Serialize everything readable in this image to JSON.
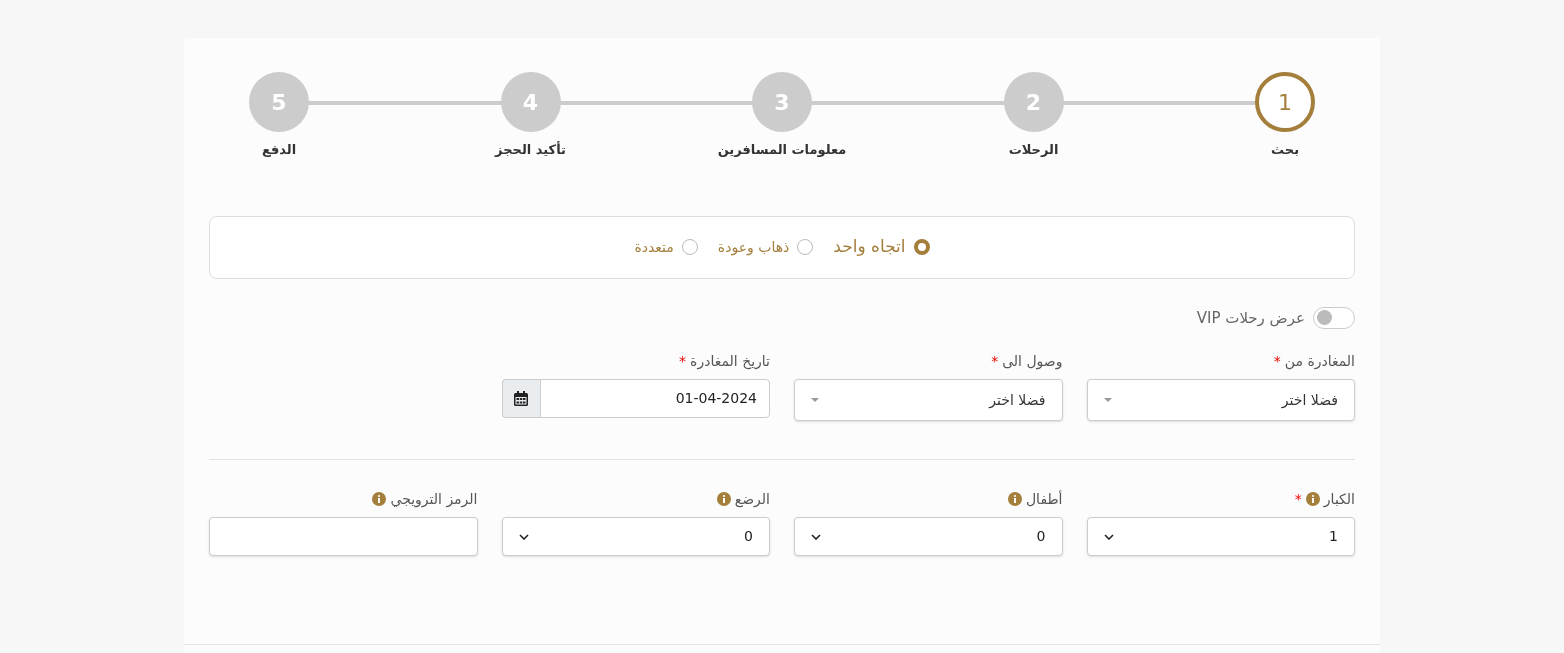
{
  "steps": [
    {
      "number": "1",
      "label": "بحث",
      "selected": true
    },
    {
      "number": "2",
      "label": "الرحلات",
      "selected": false
    },
    {
      "number": "3",
      "label": "معلومات المسافرين",
      "selected": false
    },
    {
      "number": "4",
      "label": "تأكيد الحجز",
      "selected": false
    },
    {
      "number": "5",
      "label": "الدفع",
      "selected": false
    }
  ],
  "trip_types": [
    {
      "label": "اتجاه واحد",
      "selected": true
    },
    {
      "label": "ذهاب وعودة",
      "selected": false
    },
    {
      "label": "متعددة",
      "selected": false
    }
  ],
  "vip_toggle": {
    "label": "عرض رحلات VIP",
    "on": false
  },
  "route_fields": [
    {
      "kind": "select",
      "label": "المغادرة من",
      "required_mark": "*",
      "value": "فضلا اختر"
    },
    {
      "kind": "select",
      "label": "وصول الى",
      "required_mark": "*",
      "value": "فضلا اختر"
    },
    {
      "kind": "date",
      "label": "تاريخ المغادرة",
      "required_mark": "*",
      "value": "01-04-2024"
    }
  ],
  "passenger_fields": [
    {
      "kind": "number",
      "label": "الكبار",
      "required_mark": "*",
      "value": "1"
    },
    {
      "kind": "number",
      "label": "أطفال",
      "value": "0"
    },
    {
      "kind": "number",
      "label": "الرضع",
      "value": "0"
    },
    {
      "kind": "text",
      "label": "الرمز الترويجي"
    }
  ]
}
